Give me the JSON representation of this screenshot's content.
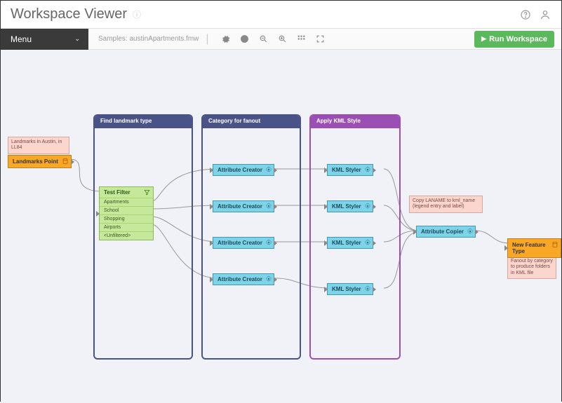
{
  "app": {
    "title": "Workspace Viewer"
  },
  "toolbar": {
    "menu_label": "Menu",
    "file_label": "Samples: austinApartments.fmw",
    "run_label": "Run Workspace"
  },
  "canvas": {
    "sticky_source": "Landmarks in Austin, in LL84",
    "reader": "Landmarks Point",
    "groups": {
      "find": "Find landmark type",
      "category": "Category for fanout",
      "kml": "Apply KML Style"
    },
    "filter": {
      "name": "Test Filter",
      "rows": [
        "Apartments",
        "School",
        "Shopping",
        "Airports",
        "<Unfiltered>"
      ]
    },
    "attribute_creator": "Attribute Creator",
    "kml_styler": "KML Styler",
    "attribute_copier": "Attribute Copier",
    "sticky_copy": "Copy LANAME to kml_name (legend entry and label)",
    "sticky_fanout": "Fanout by category to produce folders in KML file",
    "writer": "New Feature Type"
  }
}
